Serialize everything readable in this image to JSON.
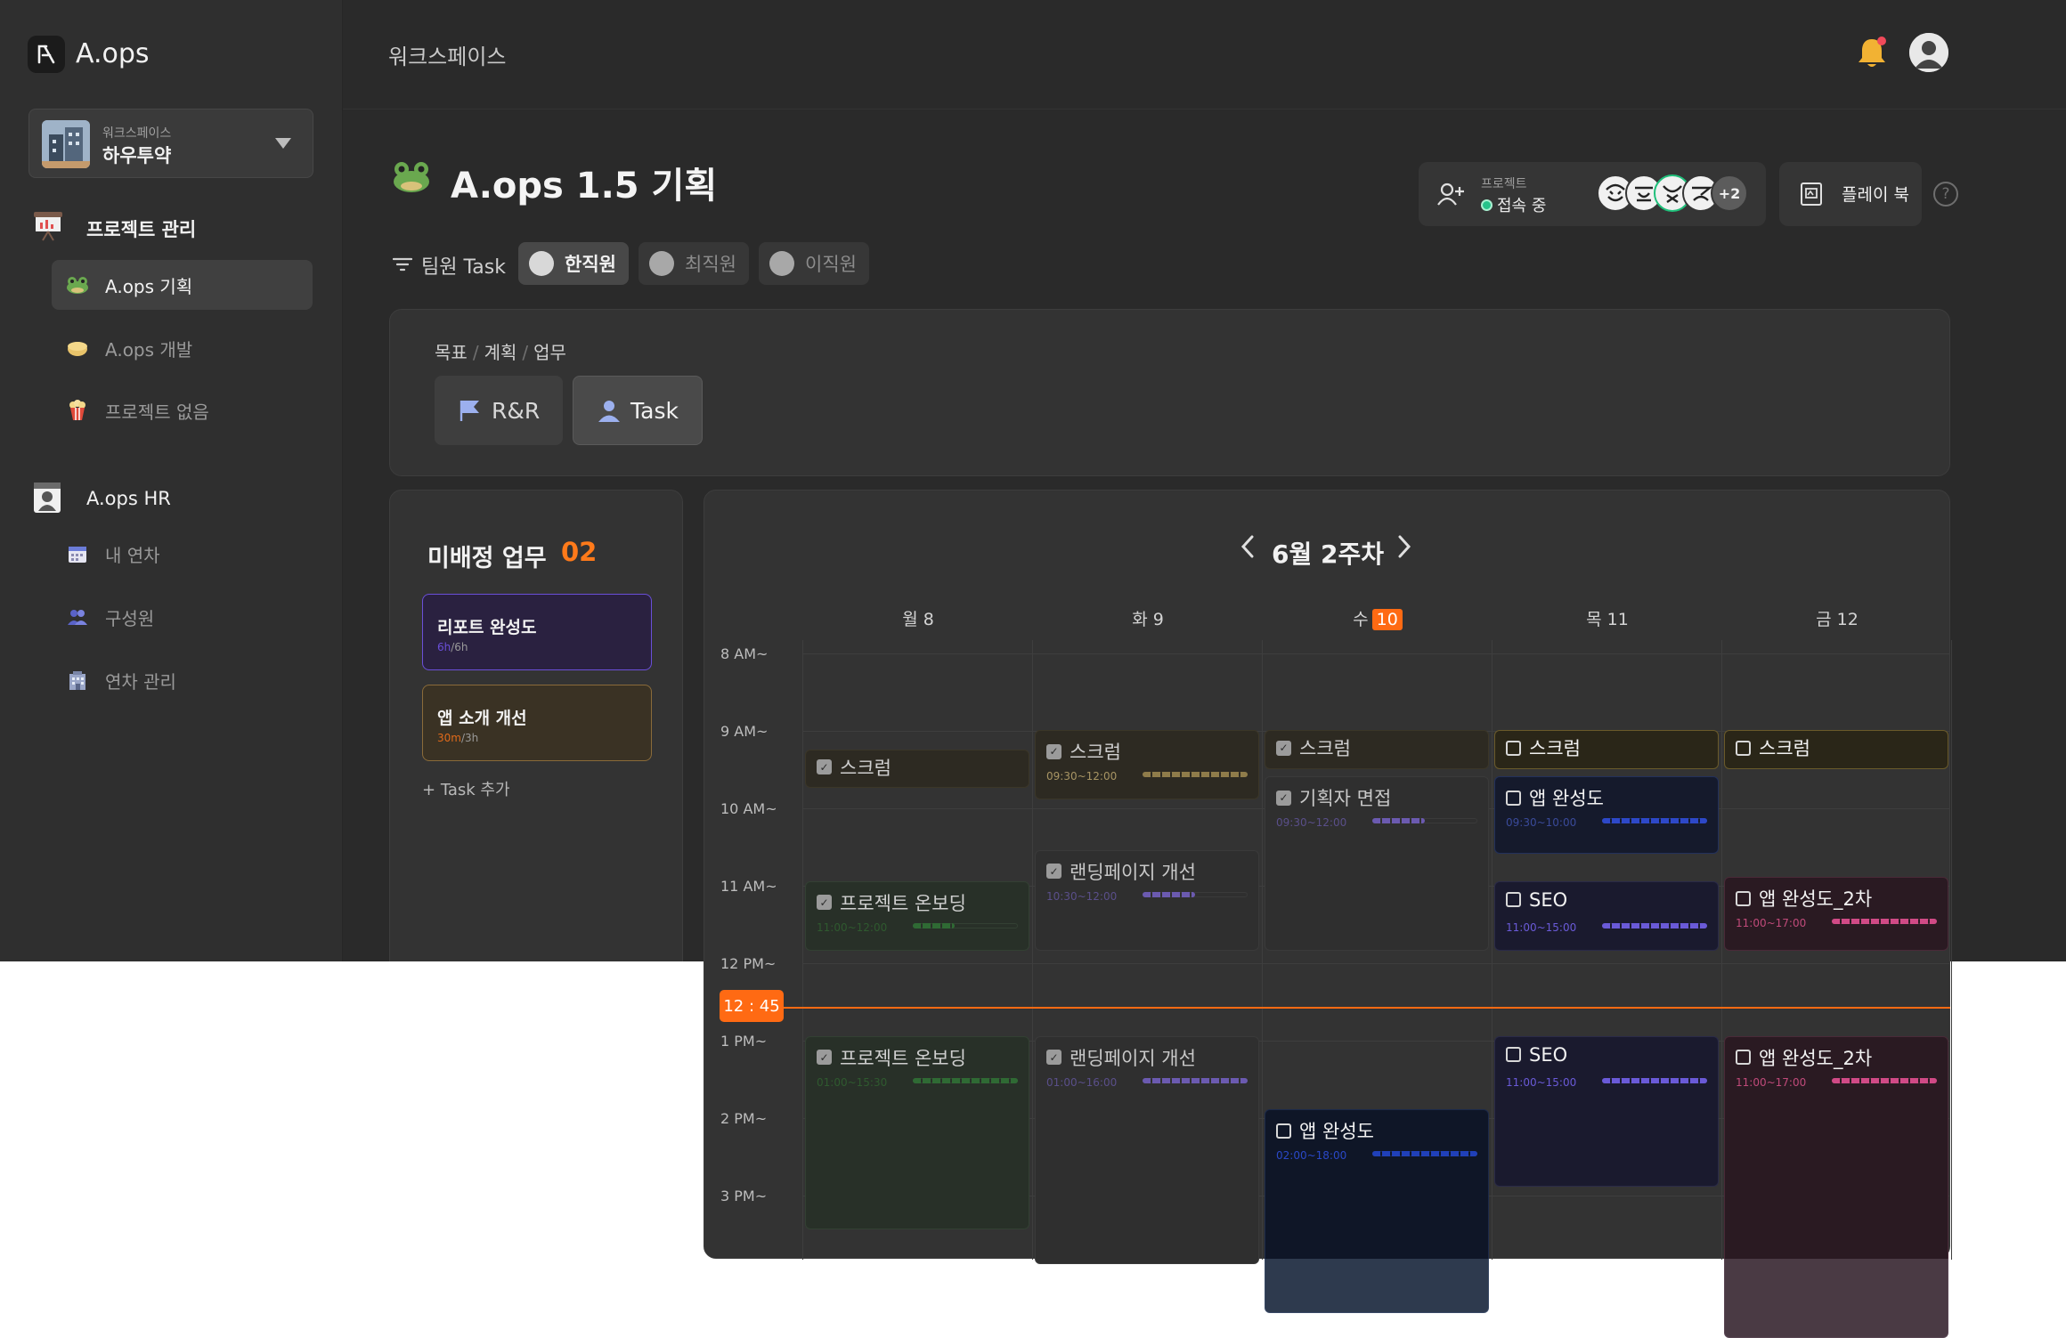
{
  "app": {
    "name": "A.ops"
  },
  "workspace": {
    "label": "워크스페이스",
    "name": "하우투약"
  },
  "sidebar": {
    "project_section": {
      "title": "프로젝트 관리"
    },
    "projects": [
      {
        "label": "A.ops 기획",
        "icon": "frog-icon",
        "active": true
      },
      {
        "label": "A.ops 개발",
        "icon": "folder-yellow-icon",
        "active": false
      },
      {
        "label": "프로젝트 없음",
        "icon": "popcorn-icon",
        "active": false
      }
    ],
    "hr_section": {
      "title": "A.ops HR"
    },
    "hr_items": [
      {
        "label": "내 연차",
        "icon": "calendar-icon"
      },
      {
        "label": "구성원",
        "icon": "people-icon"
      },
      {
        "label": "연차 관리",
        "icon": "building-icon"
      }
    ]
  },
  "header": {
    "breadcrumb": "워크스페이스"
  },
  "page": {
    "title": "A.ops 1.5 기획"
  },
  "presence": {
    "label": "프로젝트",
    "status": "접속 중",
    "avatars": [
      "",
      "",
      "",
      ""
    ],
    "more": "+2"
  },
  "playbook": {
    "label": "플레이 북"
  },
  "filter": {
    "label": "팀원 Task",
    "members": [
      {
        "name": "한직원",
        "active": true
      },
      {
        "name": "최직원",
        "active": false
      },
      {
        "name": "이직원",
        "active": false
      }
    ]
  },
  "goal": {
    "crumbs": [
      "목표",
      "계획",
      "업무"
    ],
    "buttons": [
      {
        "label": "R&R",
        "active": false
      },
      {
        "label": "Task",
        "active": true
      }
    ]
  },
  "unassigned": {
    "title": "미배정 업무",
    "count": "02",
    "cards": [
      {
        "title": "리포트 완성도",
        "used": "6h",
        "total": "/6h",
        "accent": "#6a4fd8"
      },
      {
        "title": "앱 소개 개선",
        "used": "30m",
        "total": "/3h",
        "accent": "#e06a1a"
      }
    ],
    "add_label": "Task 추가"
  },
  "calendar": {
    "week_label": "6월 2주차",
    "days": [
      {
        "label": "월 8",
        "num": ""
      },
      {
        "label": "화 9",
        "num": ""
      },
      {
        "label": "수",
        "num": "10"
      },
      {
        "label": "목 11",
        "num": ""
      },
      {
        "label": "금 12",
        "num": ""
      }
    ],
    "hours": [
      "8 AM~",
      "9 AM~",
      "10 AM~",
      "11 AM~",
      "12 PM~",
      "1 PM~",
      "2 PM~",
      "3 PM~"
    ],
    "now_label": "12 : 45",
    "events": [
      {
        "day": 0,
        "start": 9.25,
        "end": 9.75,
        "title": "스크럼",
        "time": "",
        "checked": true,
        "theme": "scrum",
        "progress": 0
      },
      {
        "day": 1,
        "start": 9.0,
        "end": 9.9,
        "title": "스크럼",
        "time": "09:30~12:00",
        "checked": true,
        "theme": "scrum",
        "progress": 1.0
      },
      {
        "day": 2,
        "start": 9.0,
        "end": 9.5,
        "title": "스크럼",
        "time": "",
        "checked": true,
        "theme": "scrum",
        "progress": 0
      },
      {
        "day": 3,
        "start": 9.0,
        "end": 9.5,
        "title": "스크럼",
        "time": "",
        "checked": false,
        "theme": "scrum-bright",
        "progress": 0
      },
      {
        "day": 4,
        "start": 9.0,
        "end": 9.5,
        "title": "스크럼",
        "time": "",
        "checked": false,
        "theme": "scrum-bright",
        "progress": 0
      },
      {
        "day": 2,
        "start": 9.6,
        "end": 11.85,
        "title": "기획자 면접",
        "time": "09:30~12:00",
        "checked": true,
        "theme": "gray",
        "progress": 0.5
      },
      {
        "day": 3,
        "start": 9.6,
        "end": 10.6,
        "title": "앱 완성도",
        "time": "09:30~10:00",
        "checked": false,
        "theme": "navy",
        "progress": 1.0
      },
      {
        "day": 1,
        "start": 10.55,
        "end": 11.85,
        "title": "랜딩페이지 개선",
        "time": "10:30~12:00",
        "checked": true,
        "theme": "gray",
        "progress": 0.5
      },
      {
        "day": 0,
        "start": 10.95,
        "end": 11.85,
        "title": "프로젝트 온보딩",
        "time": "11:00~12:00",
        "checked": true,
        "theme": "green",
        "progress": 0.4
      },
      {
        "day": 3,
        "start": 10.95,
        "end": 11.85,
        "title": "SEO",
        "time": "11:00~15:00",
        "checked": false,
        "theme": "navy-purple",
        "progress": 1.0
      },
      {
        "day": 4,
        "start": 10.9,
        "end": 11.85,
        "title": "앱 완성도_2차",
        "time": "11:00~17:00",
        "checked": false,
        "theme": "wine",
        "progress": 1.0
      },
      {
        "day": 0,
        "start": 12.95,
        "end": 15.45,
        "title": "프로젝트 온보딩",
        "time": "01:00~15:30",
        "checked": true,
        "theme": "green",
        "progress": 1.0
      },
      {
        "day": 1,
        "start": 12.95,
        "end": 15.9,
        "title": "랜딩페이지 개선",
        "time": "01:00~16:00",
        "checked": true,
        "theme": "gray",
        "progress": 1.0
      },
      {
        "day": 3,
        "start": 12.95,
        "end": 14.9,
        "title": "SEO",
        "time": "11:00~15:00",
        "checked": false,
        "theme": "navy-purple",
        "progress": 1.0
      },
      {
        "day": 4,
        "start": 12.95,
        "end": 16.0,
        "title": "앱 완성도_2차",
        "time": "11:00~17:00",
        "checked": false,
        "theme": "wine",
        "progress": 1.0
      },
      {
        "day": 2,
        "start": 13.9,
        "end": 16.0,
        "title": "앱 완성도",
        "time": "02:00~18:00",
        "checked": false,
        "theme": "deepnavy",
        "progress": 1.0
      }
    ],
    "overflow_events": [
      {
        "day": 2,
        "title": "",
        "theme": "deepnavy-tail"
      },
      {
        "day": 4,
        "title": "",
        "theme": "wine-tail"
      }
    ]
  },
  "colors": {
    "accent_orange": "#ff6a13",
    "bg": "#2a2a2a"
  }
}
